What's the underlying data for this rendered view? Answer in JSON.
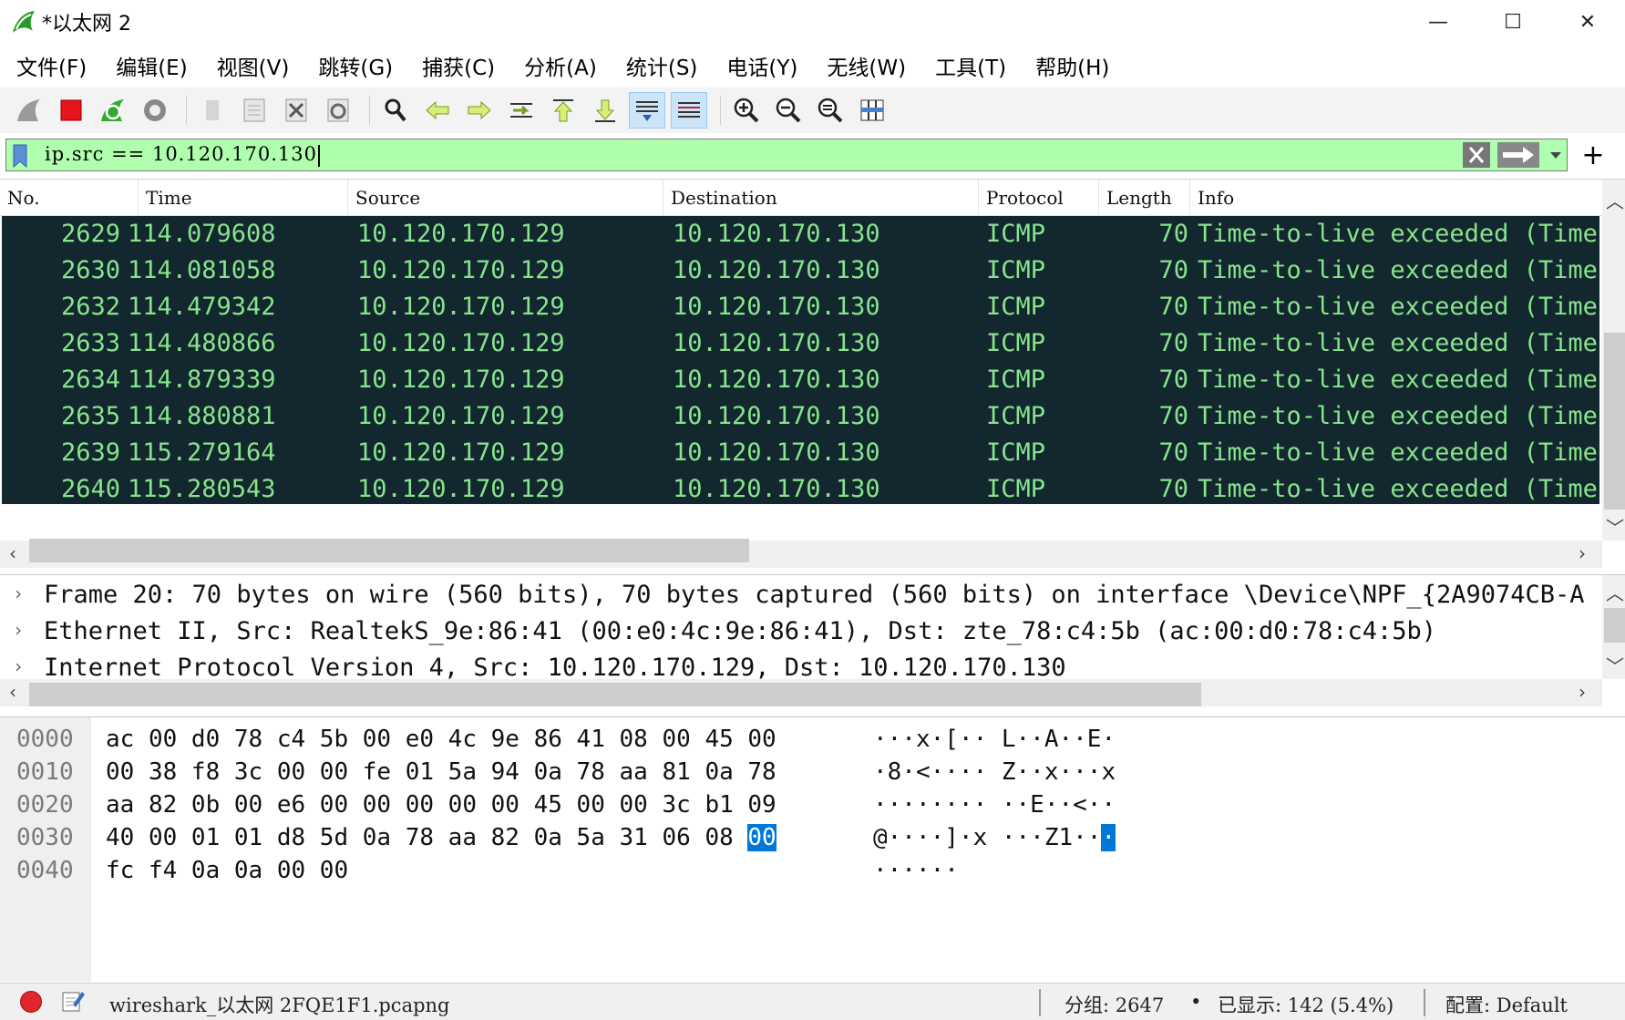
{
  "window": {
    "title": "*以太网 2",
    "minimize_glyph": "—",
    "maximize_glyph": "☐",
    "close_glyph": "✕"
  },
  "menu": [
    "文件(F)",
    "编辑(E)",
    "视图(V)",
    "跳转(G)",
    "捕获(C)",
    "分析(A)",
    "统计(S)",
    "电话(Y)",
    "无线(W)",
    "工具(T)",
    "帮助(H)"
  ],
  "toolbar": {
    "icons": [
      "start-capture-icon",
      "stop-capture-icon",
      "restart-capture-icon",
      "capture-options-icon",
      "open-file-icon",
      "save-file-icon",
      "close-file-icon",
      "reload-file-icon",
      "find-packet-icon",
      "go-back-icon",
      "go-forward-icon",
      "go-to-packet-icon",
      "go-first-icon",
      "go-last-icon",
      "auto-scroll-icon",
      "colorize-icon",
      "zoom-in-icon",
      "zoom-out-icon",
      "zoom-normal-icon",
      "resize-columns-icon"
    ]
  },
  "filter": {
    "value": "ip.src  ==  10.120.170.130",
    "bg_color": "#afffaf"
  },
  "packet_list": {
    "columns": [
      "No.",
      "Time",
      "Source",
      "Destination",
      "Protocol",
      "Length",
      "Info"
    ],
    "rows": [
      {
        "no": "2629",
        "time": "114.079608",
        "src": "10.120.170.129",
        "dst": "10.120.170.130",
        "proto": "ICMP",
        "len": "70",
        "info": "Time-to-live exceeded (Time"
      },
      {
        "no": "2630",
        "time": "114.081058",
        "src": "10.120.170.129",
        "dst": "10.120.170.130",
        "proto": "ICMP",
        "len": "70",
        "info": "Time-to-live exceeded (Time"
      },
      {
        "no": "2632",
        "time": "114.479342",
        "src": "10.120.170.129",
        "dst": "10.120.170.130",
        "proto": "ICMP",
        "len": "70",
        "info": "Time-to-live exceeded (Time"
      },
      {
        "no": "2633",
        "time": "114.480866",
        "src": "10.120.170.129",
        "dst": "10.120.170.130",
        "proto": "ICMP",
        "len": "70",
        "info": "Time-to-live exceeded (Time"
      },
      {
        "no": "2634",
        "time": "114.879339",
        "src": "10.120.170.129",
        "dst": "10.120.170.130",
        "proto": "ICMP",
        "len": "70",
        "info": "Time-to-live exceeded (Time"
      },
      {
        "no": "2635",
        "time": "114.880881",
        "src": "10.120.170.129",
        "dst": "10.120.170.130",
        "proto": "ICMP",
        "len": "70",
        "info": "Time-to-live exceeded (Time"
      },
      {
        "no": "2639",
        "time": "115.279164",
        "src": "10.120.170.129",
        "dst": "10.120.170.130",
        "proto": "ICMP",
        "len": "70",
        "info": "Time-to-live exceeded (Time"
      },
      {
        "no": "2640",
        "time": "115.280543",
        "src": "10.120.170.129",
        "dst": "10.120.170.130",
        "proto": "ICMP",
        "len": "70",
        "info": "Time-to-live exceeded (Time"
      }
    ],
    "row_bg": "#12272e",
    "row_fg": "#88e48c"
  },
  "details": [
    "Frame 20: 70 bytes on wire (560 bits), 70 bytes captured (560 bits) on interface \\Device\\NPF_{2A9074CB-A",
    "Ethernet II, Src: RealtekS_9e:86:41 (00:e0:4c:9e:86:41), Dst: zte_78:c4:5b (ac:00:d0:78:c4:5b)",
    "Internet Protocol Version 4, Src: 10.120.170.129, Dst: 10.120.170.130"
  ],
  "bytes": [
    {
      "off": "0000",
      "hex": "ac 00 d0 78 c4 5b 00 e0  4c 9e 86 41 08 00 45 00",
      "ascii": "···x·[··  L··A··E·"
    },
    {
      "off": "0010",
      "hex": "00 38 f8 3c 00 00 fe 01  5a 94 0a 78 aa 81 0a 78",
      "ascii": "·8·<····  Z··x···x"
    },
    {
      "off": "0020",
      "hex": "aa 82 0b 00 e6 00 00 00  00 00 45 00 00 3c b1 09",
      "ascii": "········  ··E··<··"
    },
    {
      "off": "0030",
      "hex_pre": "40 00 01 01 d8 5d 0a 78  aa 82 0a 5a 31 06 08 ",
      "hex_sel": "00",
      "ascii_pre": "@····]·x  ···Z1··",
      "ascii_sel": "·"
    },
    {
      "off": "0040",
      "hex": "fc f4 0a 0a 00 00",
      "ascii": "······"
    }
  ],
  "status": {
    "file": "wireshark_以太网 2FQE1F1.pcapng",
    "groups": "分组: 2647",
    "dot": "•",
    "shown": "已显示: 142 (5.4%)",
    "profile": "配置: Default"
  }
}
